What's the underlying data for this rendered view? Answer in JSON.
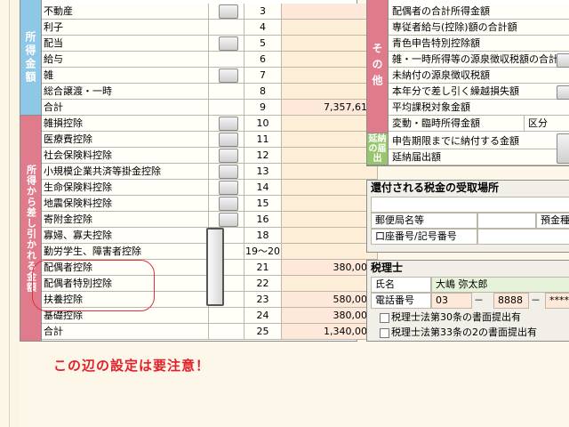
{
  "sections": {
    "income": "所得金額",
    "deductions": "所得から差し引かれる金額"
  },
  "income_rows": [
    {
      "label": "不動産",
      "num": "3",
      "value": "0",
      "button": true
    },
    {
      "label": "利子",
      "num": "4",
      "value": "",
      "button": false
    },
    {
      "label": "配当",
      "num": "5",
      "value": "",
      "button": true
    },
    {
      "label": "給与",
      "num": "6",
      "value": "",
      "button": false
    },
    {
      "label": "雑",
      "num": "7",
      "value": "",
      "button": true
    },
    {
      "label": "総合譲渡・一時",
      "num": "8",
      "value": "",
      "button": false
    },
    {
      "label": "合計",
      "num": "9",
      "value": "7,357,611",
      "button": false
    }
  ],
  "deduction_rows": [
    {
      "label": "雑損控除",
      "num": "10",
      "value": "",
      "button": true
    },
    {
      "label": "医療費控除",
      "num": "11",
      "value": "",
      "button": true
    },
    {
      "label": "社会保険料控除",
      "num": "12",
      "value": "",
      "button": true
    },
    {
      "label": "小規模企業共済等掛金控除",
      "num": "13",
      "value": "",
      "button": true
    },
    {
      "label": "生命保険料控除",
      "num": "14",
      "value": "",
      "button": true
    },
    {
      "label": "地震保険料控除",
      "num": "15",
      "value": "",
      "button": true
    },
    {
      "label": "寄附金控除",
      "num": "16",
      "value": "",
      "button": true
    },
    {
      "label": "寡婦、寡夫控除",
      "num": "18",
      "value": "",
      "button": false
    },
    {
      "label": "勤労学生、障害者控除",
      "num": "19〜20",
      "value": "",
      "button": false
    },
    {
      "label": "配偶者控除",
      "num": "21",
      "value": "380,000",
      "button": false
    },
    {
      "label": "配偶者特別控除",
      "num": "22",
      "value": "",
      "button": false
    },
    {
      "label": "扶養控除",
      "num": "23",
      "value": "580,000",
      "button": false
    },
    {
      "label": "基礎控除",
      "num": "24",
      "value": "380,000",
      "button": false
    },
    {
      "label": "合計",
      "num": "25",
      "value": "1,340,000",
      "button": false
    }
  ],
  "note": "この辺の設定は要注意！",
  "right_sections": {
    "other": "その他",
    "extension": "延納の届出"
  },
  "other_rows": [
    "配偶者の合計所得金額",
    "専従者給与(控除)額の合計額",
    "青色申告特別控除額",
    "雑・一時所得等の源泉徴収税額の合計額",
    "未納付の源泉徴収税額",
    "本年分で差し引く繰越損失額",
    "平均課税対象金額",
    "変動・臨時所得金額"
  ],
  "category_label": "区分",
  "extension_rows": [
    "申告期限までに納付する金額",
    "延納届出額"
  ],
  "refund": {
    "title": "還付される税金の受取場所",
    "postal_label": "郵便局名等",
    "deposit_label": "預金種",
    "account_label": "口座番号/記号番号"
  },
  "tax_accountant": {
    "title": "税理士",
    "name_label": "氏名",
    "name": "大嶋 弥太郎",
    "phone_label": "電話番号",
    "phone_1": "03",
    "phone_2": "8888",
    "phone_3": "****",
    "dash": "－",
    "check_30": "税理士法第30条の書面提出有",
    "check_33": "税理士法第33条の2の書面提出有"
  }
}
